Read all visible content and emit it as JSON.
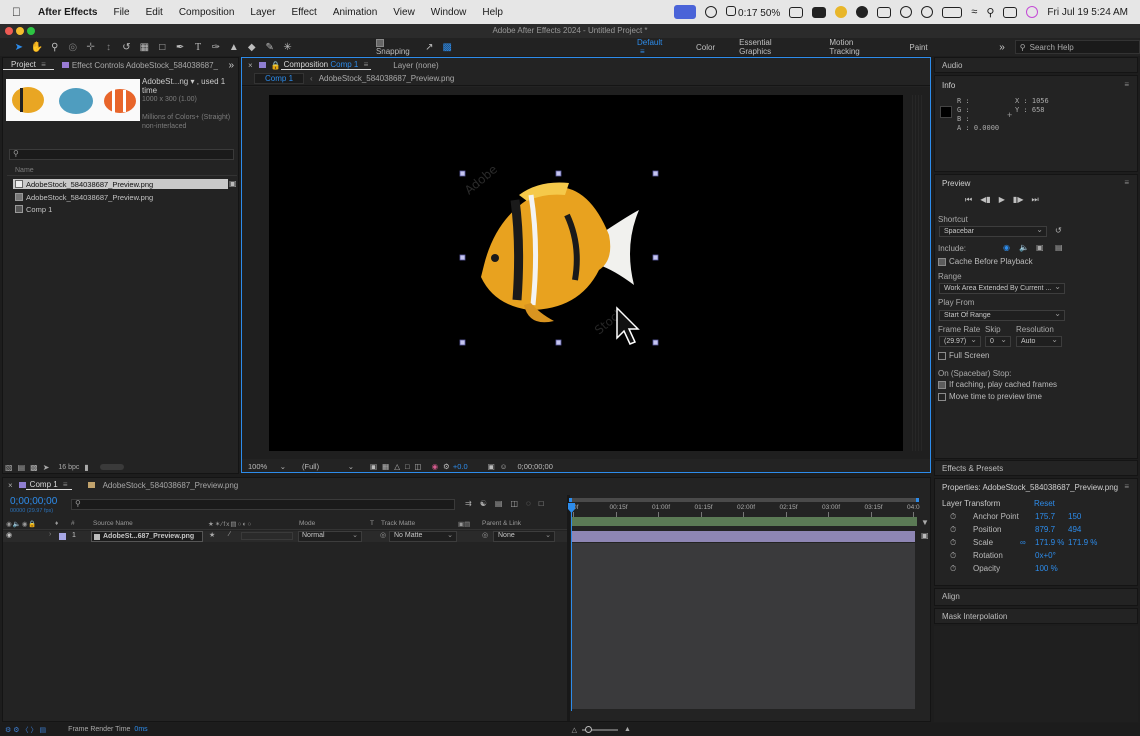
{
  "menubar": {
    "app": "After Effects",
    "items": [
      "File",
      "Edit",
      "Composition",
      "Layer",
      "Effect",
      "Animation",
      "View",
      "Window",
      "Help"
    ],
    "battery_text": "0:17 50%",
    "clock": "Fri Jul 19  5:24 AM"
  },
  "window": {
    "title": "Adobe After Effects 2024 - Untitled Project *"
  },
  "toolbar": {
    "snapping_label": "Snapping",
    "workspaces": [
      "Default",
      "Color",
      "Essential Graphics",
      "Motion Tracking",
      "Paint"
    ],
    "search_placeholder": "Search Help"
  },
  "project": {
    "tab_project": "Project",
    "tab_effect_controls": "Effect Controls AdobeStock_584038687_",
    "asset_name": "AdobeSt...ng ▾ , used 1 time",
    "asset_size": "1000 x 300 (1.00)",
    "asset_colors": "Millions of Colors+ (Straight)",
    "asset_interlace": "non-interlaced",
    "column_name": "Name",
    "items": [
      "AdobeStock_584038687_Preview.png",
      "AdobeStock_584038687_Preview.png",
      "Comp 1"
    ],
    "bpc": "16 bpc"
  },
  "composition": {
    "tab_label": "Composition",
    "tab_comp_name": "Comp 1",
    "tab_layer": "Layer (none)",
    "breadcrumb_comp": "Comp 1",
    "breadcrumb_layer": "AdobeStock_584038687_Preview.png",
    "zoom": "100%",
    "resolution": "(Full)",
    "exposure": "+0.0",
    "timecode": "0;00;00;00"
  },
  "info": {
    "title": "Audio",
    "info_title": "Info",
    "r": "R :",
    "g": "G :",
    "b": "B :",
    "a": "A :  0.0000",
    "x": "X : 1056",
    "y": "Y : 658"
  },
  "preview": {
    "title": "Preview",
    "shortcut_label": "Shortcut",
    "shortcut_value": "Spacebar",
    "include_label": "Include:",
    "cache_label": "Cache Before Playback",
    "range_label": "Range",
    "range_value": "Work Area Extended By Current ...",
    "play_from_label": "Play From",
    "play_from_value": "Start Of Range",
    "frame_rate_label": "Frame Rate",
    "skip_label": "Skip",
    "resolution_label": "Resolution",
    "frame_rate_value": "(29.97)",
    "skip_value": "0",
    "resolution_value": "Auto",
    "full_screen_label": "Full Screen",
    "stop_label": "On (Spacebar) Stop:",
    "if_caching_label": "If caching, play cached frames",
    "move_time_label": "Move time to preview time"
  },
  "effects_presets": {
    "title": "Effects & Presets"
  },
  "properties": {
    "title": "Properties: AdobeStock_584038687_Preview.png",
    "layer_transform": "Layer Transform",
    "reset": "Reset",
    "rows": [
      {
        "label": "Anchor Point",
        "v1": "175.7",
        "v2": "150"
      },
      {
        "label": "Position",
        "v1": "879.7",
        "v2": "494"
      },
      {
        "label": "Scale",
        "v1": "171.9 %",
        "v2": "171.9 %"
      },
      {
        "label": "Rotation",
        "v1": "0x+0°",
        "v2": ""
      },
      {
        "label": "Opacity",
        "v1": "100 %",
        "v2": ""
      }
    ]
  },
  "align": {
    "title": "Align"
  },
  "mask_interpolation": {
    "title": "Mask Interpolation"
  },
  "timeline": {
    "tab_comp": "Comp 1",
    "tab_asset": "AdobeStock_584038687_Preview.png",
    "timecode": "0;00;00;00",
    "fps": "00000 (29.97 fps)",
    "col_source_name": "Source Name",
    "col_mode": "Mode",
    "col_t": "T",
    "col_track_matte": "Track Matte",
    "col_parent": "Parent & Link",
    "layer_number": "1",
    "layer_name": "AdobeSt...687_Preview.png",
    "layer_mode": "Normal",
    "layer_matte": "No Matte",
    "layer_parent": "None",
    "ruler": [
      "0f",
      "00:15f",
      "01:00f",
      "01:15f",
      "02:00f",
      "02:15f",
      "03:00f",
      "03:15f",
      "04:0"
    ],
    "render_label": "Frame Render Time",
    "render_value": "0ms"
  },
  "colors": {
    "accent": "#2d8ceb",
    "layer_bar": "#8e86b4",
    "work_area": "#3a9a3a"
  }
}
